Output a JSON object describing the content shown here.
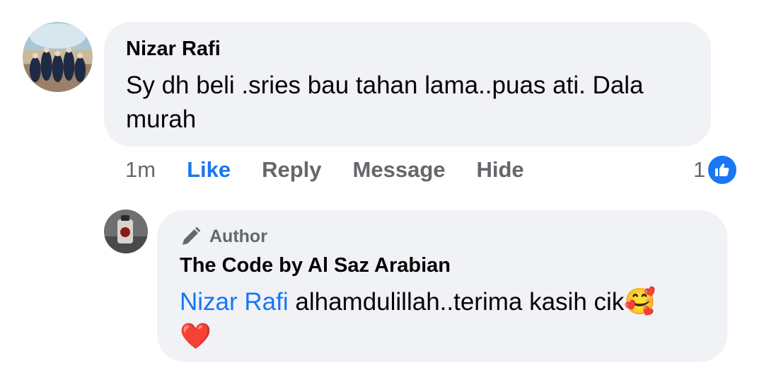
{
  "comment": {
    "author": "Nizar Rafi",
    "text_line1": "Sy dh beli .sries bau tahan lama..puas ati. Dala",
    "text_line2": "murah",
    "time": "1m",
    "actions": {
      "like": "Like",
      "reply": "Reply",
      "message": "Message",
      "hide": "Hide"
    },
    "like_count": "1",
    "avatar_icon": "group-photo-avatar"
  },
  "reply": {
    "badge": "Author",
    "badge_icon": "pencil-icon",
    "author": "The Code by Al Saz Arabian",
    "mention": "Nizar Rafi",
    "text": "alhamdulillah..terima kasih cik",
    "emoji1": "🥰",
    "emoji2": "❤️",
    "avatar_icon": "perfume-bottle-avatar"
  },
  "colors": {
    "accent": "#1877f2",
    "bubble": "#f0f2f5",
    "muted": "#65676b"
  }
}
